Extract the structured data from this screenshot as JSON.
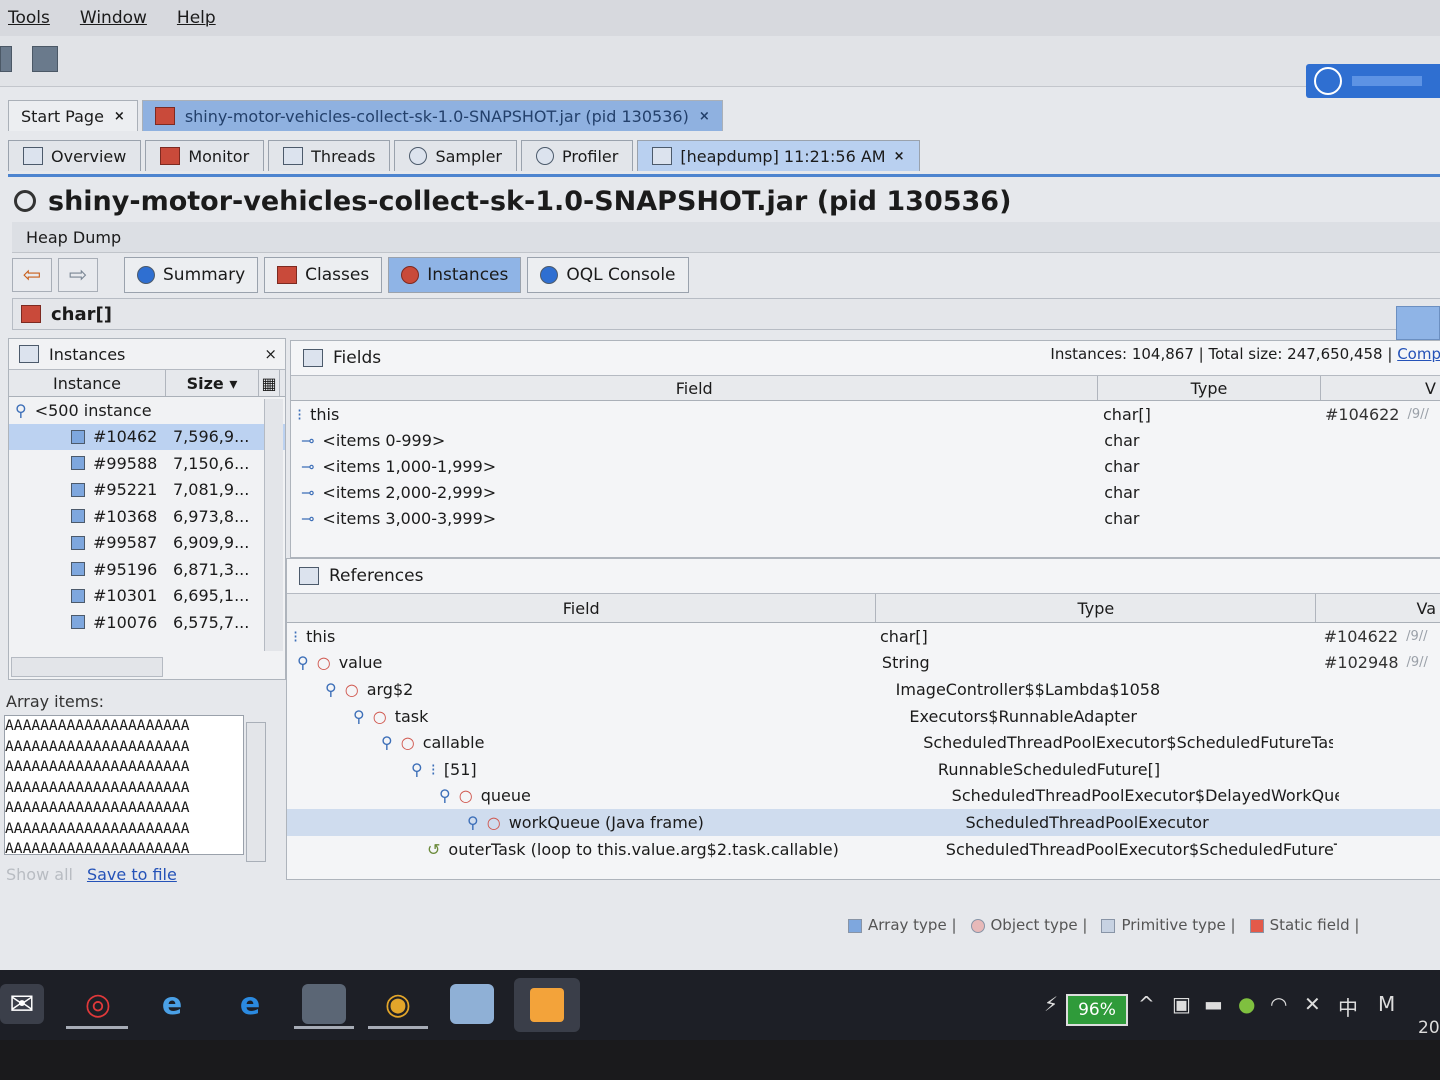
{
  "menu": [
    "Tools",
    "Window",
    "Help"
  ],
  "doc_tabs": [
    {
      "label": "Start Page",
      "close": "×"
    },
    {
      "label": "shiny-motor-vehicles-collect-sk-1.0-SNAPSHOT.jar (pid 130536)",
      "close": "×"
    }
  ],
  "sub_tabs": [
    {
      "label": "Overview"
    },
    {
      "label": "Monitor"
    },
    {
      "label": "Threads"
    },
    {
      "label": "Sampler"
    },
    {
      "label": "Profiler"
    },
    {
      "label": "[heapdump] 11:21:56 AM",
      "close": "×"
    }
  ],
  "title": "shiny-motor-vehicles-collect-sk-1.0-SNAPSHOT.jar (pid 130536)",
  "heap_dump_label": "Heap Dump",
  "nav": {
    "back": "⇦",
    "forward": "⇨"
  },
  "view_buttons": [
    "Summary",
    "Classes",
    "Instances",
    "OQL Console"
  ],
  "breadcrumb": "char[]",
  "instances_pane": {
    "title": "Instances",
    "close": "×",
    "col_instance": "Instance",
    "col_size": "Size ▾",
    "group": "<500 instance",
    "rows": [
      {
        "id": "#10462",
        "size": "7,596,9..."
      },
      {
        "id": "#99588",
        "size": "7,150,6..."
      },
      {
        "id": "#95221",
        "size": "7,081,9..."
      },
      {
        "id": "#10368",
        "size": "6,973,8..."
      },
      {
        "id": "#99587",
        "size": "6,909,9..."
      },
      {
        "id": "#95196",
        "size": "6,871,3..."
      },
      {
        "id": "#10301",
        "size": "6,695,1..."
      },
      {
        "id": "#10076",
        "size": "6,575,7..."
      }
    ]
  },
  "array_items": {
    "label": "Array items:",
    "lines": [
      "AAAAAAAAAAAAAAAAAAAAA",
      "AAAAAAAAAAAAAAAAAAAAA",
      "AAAAAAAAAAAAAAAAAAAAA",
      "AAAAAAAAAAAAAAAAAAAAA",
      "AAAAAAAAAAAAAAAAAAAAA",
      "AAAAAAAAAAAAAAAAAAAAA",
      "AAAAAAAAAAAAAAAAAAAAA"
    ],
    "show_all": "Show all",
    "save": "Save to file"
  },
  "fields_pane": {
    "title": "Fields",
    "stats": "Instances: 104,867  |  Total size: 247,650,458  |",
    "stats_link": "Comp",
    "col_field": "Field",
    "col_type": "Type",
    "col_value": "V",
    "rows": [
      {
        "field": "this",
        "type": "char[]",
        "value": "#104622",
        "extra": "/9//"
      },
      {
        "field": "<items 0-999>",
        "type": "char",
        "value": "",
        "extra": ""
      },
      {
        "field": "<items 1,000-1,999>",
        "type": "char",
        "value": "",
        "extra": ""
      },
      {
        "field": "<items 2,000-2,999>",
        "type": "char",
        "value": "",
        "extra": ""
      },
      {
        "field": "<items 3,000-3,999>",
        "type": "char",
        "value": "",
        "extra": ""
      }
    ]
  },
  "refs_pane": {
    "title": "References",
    "col_field": "Field",
    "col_type": "Type",
    "col_value": "Va",
    "rows": [
      {
        "field": "this",
        "type": "char[]",
        "value": "#104622",
        "extra": "/9//"
      },
      {
        "field": "value",
        "type": "String",
        "value": "#102948",
        "extra": "/9//"
      },
      {
        "field": "arg$2",
        "type": "ImageController$$Lambda$1058",
        "value": "",
        "extra": ""
      },
      {
        "field": "task",
        "type": "Executors$RunnableAdapter",
        "value": "",
        "extra": ""
      },
      {
        "field": "callable",
        "type": "ScheduledThreadPoolExecutor$ScheduledFutureTask",
        "value": "",
        "extra": ""
      },
      {
        "field": "[51]",
        "type": "RunnableScheduledFuture[]",
        "value": "",
        "extra": ""
      },
      {
        "field": "queue",
        "type": "ScheduledThreadPoolExecutor$DelayedWorkQueue",
        "value": "",
        "extra": ""
      },
      {
        "field": "workQueue (Java frame)",
        "type": "ScheduledThreadPoolExecutor",
        "value": "",
        "extra": ""
      },
      {
        "field": "outerTask (loop to this.value.arg$2.task.callable)",
        "type": "ScheduledThreadPoolExecutor$ScheduledFutureTask",
        "value": "",
        "extra": ""
      }
    ]
  },
  "legend": [
    "Array type |",
    "Object type |",
    "Primitive type |",
    "Static field |"
  ],
  "taskbar": {
    "battery": "96%",
    "clock": "20",
    "ime": "中",
    "ime2": "M"
  }
}
